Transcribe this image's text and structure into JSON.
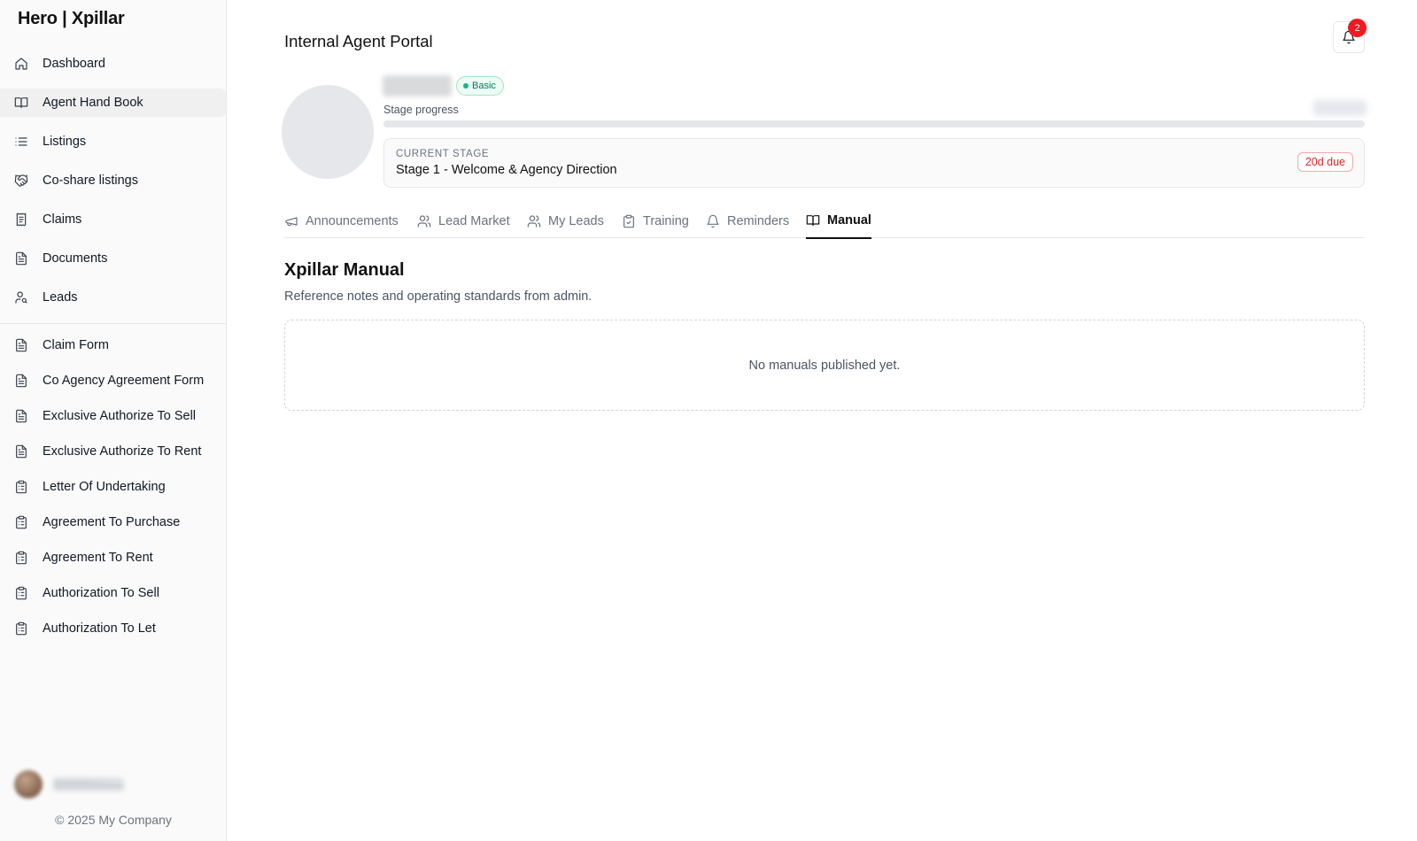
{
  "brand": "Hero | Xpillar",
  "sidebar": {
    "items": [
      {
        "label": "Dashboard",
        "icon": "home-icon"
      },
      {
        "label": "Agent Hand Book",
        "icon": "book-open-icon",
        "active": true
      },
      {
        "label": "Listings",
        "icon": "list-icon"
      },
      {
        "label": "Co-share listings",
        "icon": "handshake-icon"
      },
      {
        "label": "Claims",
        "icon": "receipt-icon"
      },
      {
        "label": "Documents",
        "icon": "file-text-icon"
      },
      {
        "label": "Leads",
        "icon": "user-search-icon"
      }
    ],
    "forms": [
      {
        "label": "Claim Form",
        "icon": "file-text-icon"
      },
      {
        "label": "Co Agency Agreement Form",
        "icon": "file-text-icon"
      },
      {
        "label": "Exclusive Authorize To Sell",
        "icon": "file-text-icon"
      },
      {
        "label": "Exclusive Authorize To Rent",
        "icon": "file-text-icon"
      },
      {
        "label": "Letter Of Undertaking",
        "icon": "clipboard-list-icon"
      },
      {
        "label": "Agreement To Purchase",
        "icon": "clipboard-list-icon"
      },
      {
        "label": "Agreement To Rent",
        "icon": "clipboard-list-icon"
      },
      {
        "label": "Authorization To Sell",
        "icon": "clipboard-list-icon"
      },
      {
        "label": "Authorization To Let",
        "icon": "clipboard-list-icon"
      }
    ],
    "copyright": "© 2025 My Company"
  },
  "header": {
    "title": "Internal Agent Portal",
    "notifications_count": "2"
  },
  "profile": {
    "tier": "Basic",
    "stage_progress_label": "Stage progress",
    "progress": 0,
    "current_stage_caption": "CURRENT STAGE",
    "current_stage": "Stage 1 - Welcome & Agency Direction",
    "due": "20d due"
  },
  "tabs": [
    {
      "label": "Announcements",
      "icon": "megaphone-icon"
    },
    {
      "label": "Lead Market",
      "icon": "users-icon"
    },
    {
      "label": "My Leads",
      "icon": "users-icon"
    },
    {
      "label": "Training",
      "icon": "clipboard-check-icon"
    },
    {
      "label": "Reminders",
      "icon": "bell-icon"
    },
    {
      "label": "Manual",
      "icon": "book-open-icon",
      "active": true
    }
  ],
  "manual": {
    "title": "Xpillar Manual",
    "subtitle": "Reference notes and operating standards from admin.",
    "empty_text": "No manuals published yet."
  },
  "colors": {
    "accent": "#111827",
    "badge_red": "#ef1b23",
    "tier_green": "#047857",
    "due_red": "#dc2626"
  }
}
